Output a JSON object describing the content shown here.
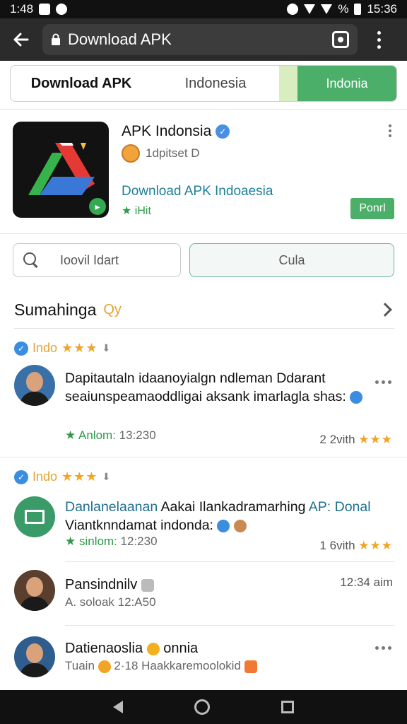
{
  "status_bar": {
    "time_left": "1:48",
    "battery": "%",
    "time_right": "15:36"
  },
  "toolbar": {
    "url": "Download APK"
  },
  "tabs": [
    "Download APK",
    "Indonesia",
    "Indonia"
  ],
  "app": {
    "title": "APK Indonsia",
    "developer": "1dpitset D",
    "subtitle": "Download APK Indoaesia",
    "subtitle2": "★ iHit",
    "install": "Ponrl"
  },
  "search": {
    "value": "Ioovil Idart",
    "button": "Cula"
  },
  "section": {
    "title": "Sumahinga",
    "badge": "Qy"
  },
  "reviews": [
    {
      "tag": "Indo",
      "stars": "★★★",
      "text": "Dapitautaln idaanoyialgn ndleman Ddarant seaiunspeamaoddligai aksank imarlagla shas:",
      "meta_star": "★ Anlom:",
      "meta_time": "13:230",
      "right_count": "2",
      "right_label": "2vith",
      "right_stars": "★★★"
    },
    {
      "tag": "Indo",
      "stars": "★★★",
      "text_link": "Danlanelaanan",
      "text_rest": "Aakai Ilankadramarhing",
      "text_link2": "AP: Donal",
      "text_line2": "Viantknndamat indonda:",
      "meta_star": "★ sinlom:",
      "meta_time": "12:230",
      "right_count": "1",
      "right_label": "6vith",
      "right_stars": "★★★"
    },
    {
      "name": "Pansindnilv",
      "meta": "A. soloak 12:A50",
      "right": "12:34 aim"
    },
    {
      "name": "Datienaoslia",
      "name_suffix": "onnia",
      "meta": "Tuain",
      "meta2": "2·18 Haakkaremoolokid"
    }
  ]
}
